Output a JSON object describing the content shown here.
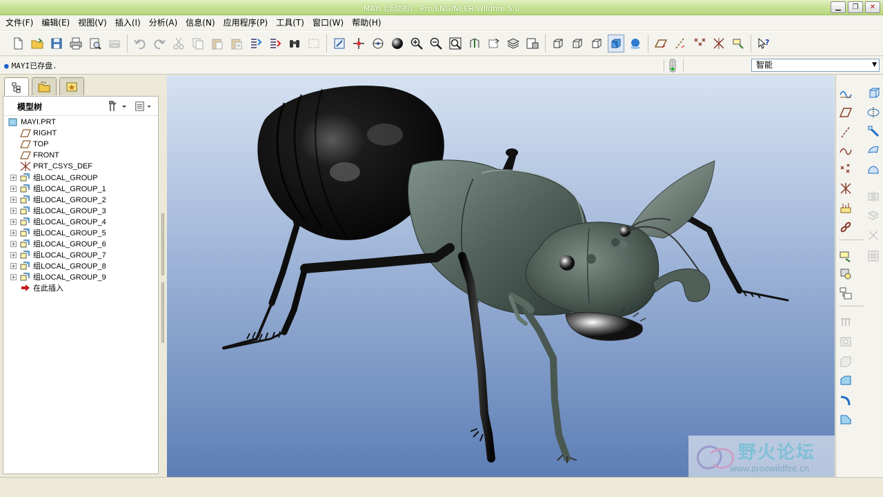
{
  "window": {
    "title": "MAYI (活动的) - Pro/ENGINEER Wildfire 5.0",
    "buttons": {
      "minimize": "▁",
      "restore": "❐",
      "close": "✕"
    }
  },
  "menubar": {
    "items": [
      "文件(F)",
      "编辑(E)",
      "视图(V)",
      "插入(I)",
      "分析(A)",
      "信息(N)",
      "应用程序(P)",
      "工具(T)",
      "窗口(W)",
      "帮助(H)"
    ]
  },
  "message": {
    "text": "MAYI已存盘."
  },
  "filter": {
    "value": "智能"
  },
  "model_tree": {
    "title": "模型树",
    "root": "MAYI.PRT",
    "datums": [
      "RIGHT",
      "TOP",
      "FRONT"
    ],
    "csys": "PRT_CSYS_DEF",
    "groups": [
      "组LOCAL_GROUP",
      "组LOCAL_GROUP_1",
      "组LOCAL_GROUP_2",
      "组LOCAL_GROUP_3",
      "组LOCAL_GROUP_4",
      "组LOCAL_GROUP_5",
      "组LOCAL_GROUP_6",
      "组LOCAL_GROUP_7",
      "组LOCAL_GROUP_8",
      "组LOCAL_GROUP_9"
    ],
    "insert_here": "在此插入"
  },
  "watermark": {
    "name": "野火论坛",
    "url": "www.proewildfire.cn"
  },
  "colors": {
    "titlebar": "#b6d77c",
    "viewport_top": "#d6e2f2",
    "viewport_bottom": "#5d7eb5",
    "ant_dark": "#151515",
    "ant_green": "#4f5f57"
  }
}
